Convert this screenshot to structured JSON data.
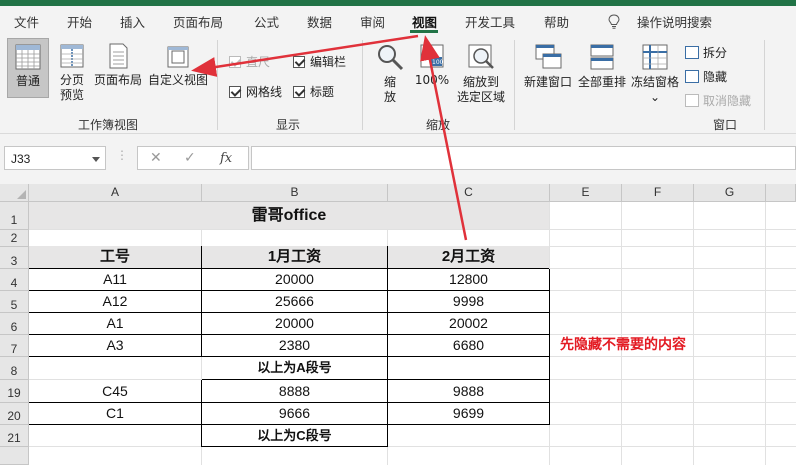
{
  "ribbon_tabs": [
    {
      "label": "文件"
    },
    {
      "label": "开始"
    },
    {
      "label": "插入"
    },
    {
      "label": "页面布局"
    },
    {
      "label": "公式"
    },
    {
      "label": "数据"
    },
    {
      "label": "审阅"
    },
    {
      "label": "视图"
    },
    {
      "label": "开发工具"
    },
    {
      "label": "帮助"
    },
    {
      "label": "操作说明搜索"
    }
  ],
  "active_tab": "视图",
  "groups": {
    "workbook_views": {
      "label": "工作簿视图",
      "normal": "普通",
      "page_break_1": "分页",
      "page_break_2": "预览",
      "page_layout": "页面布局",
      "custom_views": "自定义视图"
    },
    "show": {
      "label": "显示",
      "ruler": "直尺",
      "formula_bar": "编辑栏",
      "gridlines": "网格线",
      "headings": "标题"
    },
    "zoom": {
      "label": "缩放",
      "zoom_1": "缩",
      "zoom_2": "放",
      "hundred": "100%",
      "zoom_sel_1": "缩放到",
      "zoom_sel_2": "选定区域"
    },
    "window": {
      "label": "窗口",
      "new_window": "新建窗口",
      "arrange_all": "全部重排",
      "freeze_panes": "冻结窗格",
      "split": "拆分",
      "hide": "隐藏",
      "unhide": "取消隐藏"
    }
  },
  "formula_bar": {
    "name_box": "J33",
    "fx": "fx",
    "formula": ""
  },
  "columns": [
    "A",
    "B",
    "C",
    "E",
    "F",
    "G"
  ],
  "rows": [
    "1",
    "2",
    "3",
    "4",
    "5",
    "6",
    "7",
    "8",
    "19",
    "20",
    "21"
  ],
  "sheet": {
    "title": "雷哥office",
    "headers": [
      "工号",
      "1月工资",
      "2月工资"
    ],
    "data_rows": [
      [
        "A11",
        "20000",
        "12800"
      ],
      [
        "A12",
        "25666",
        "9998"
      ],
      [
        "A1",
        "20000",
        "20002"
      ],
      [
        "A3",
        "2380",
        "6680"
      ]
    ],
    "subtotal_a": "以上为A段号",
    "data_rows_2": [
      [
        "C45",
        "8888",
        "9888"
      ],
      [
        "C1",
        "9666",
        "9699"
      ]
    ],
    "subtotal_c": "以上为C段号"
  },
  "annotation": "先隐藏不需要的内容",
  "colors": {
    "accent": "#217346",
    "annotation": "#e31b23",
    "arrow": "#e0313a",
    "title_fill": "#e7e6e6"
  }
}
